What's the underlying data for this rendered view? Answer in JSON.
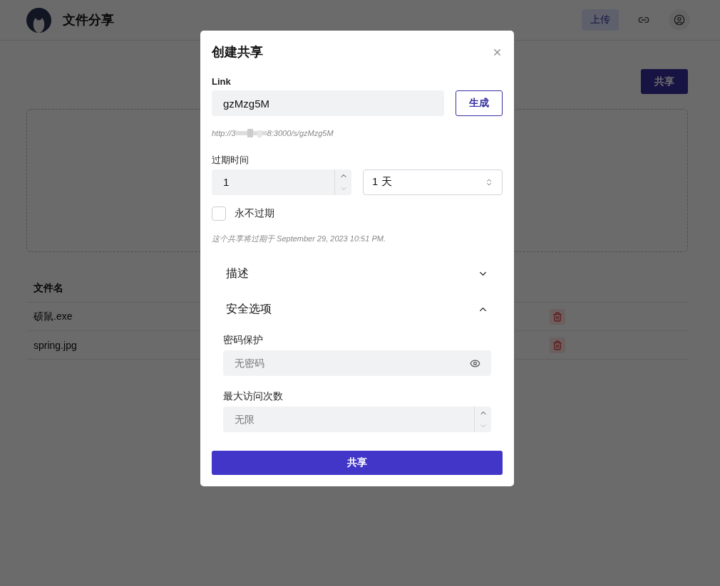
{
  "header": {
    "title": "文件分享",
    "upload_button": "上传"
  },
  "page": {
    "share_button": "共享",
    "table": {
      "columns": [
        "文件名"
      ],
      "rows": [
        {
          "name": "硕鼠.exe"
        },
        {
          "name": "spring.jpg"
        }
      ]
    }
  },
  "dialog": {
    "title": "创建共享",
    "link": {
      "label": "Link",
      "value": "gzMzg5M",
      "generate_button": "生成",
      "url_start": "http://3",
      "url_end": "8:3000/s/gzMzg5M"
    },
    "expiration": {
      "label": "过期时间",
      "amount": "1",
      "unit": "1 天",
      "never": {
        "label": "永不过期",
        "checked": false
      },
      "note": "这个共享将过期于 September 29, 2023 10:51 PM."
    },
    "sections": [
      {
        "title": "描述",
        "expanded": false
      },
      {
        "title": "安全选项",
        "expanded": true,
        "fields": [
          {
            "label": "密码保护",
            "placeholder": "无密码",
            "kind": "password"
          },
          {
            "label": "最大访问次数",
            "placeholder": "无限",
            "kind": "number"
          }
        ]
      }
    ],
    "submit_button": "共享"
  }
}
